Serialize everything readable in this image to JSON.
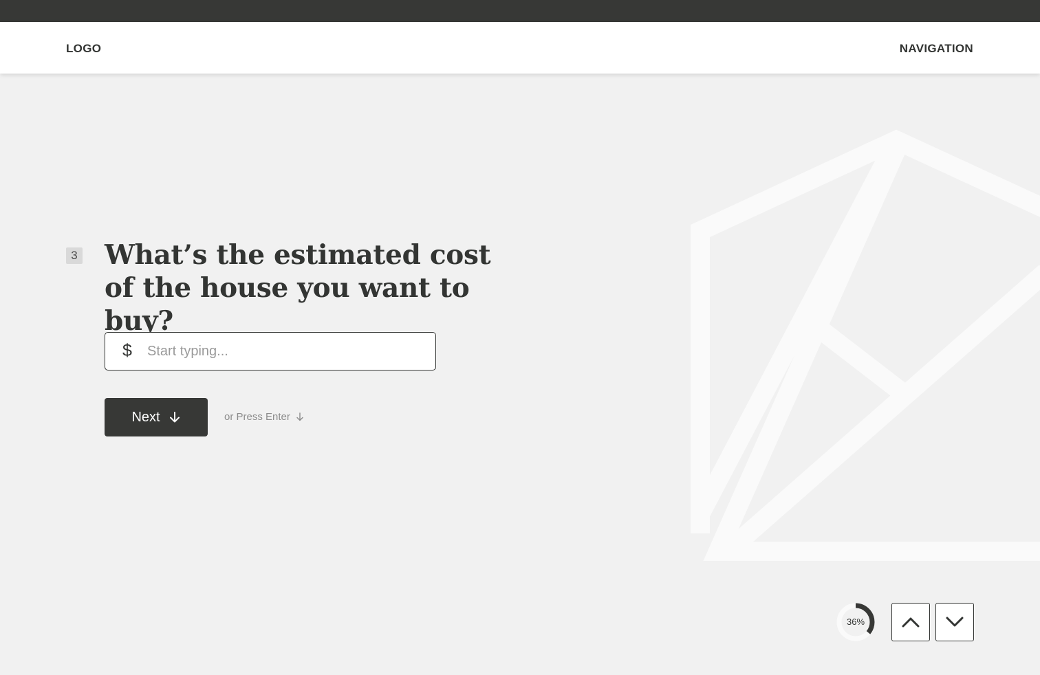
{
  "header": {
    "logo": "LOGO",
    "navigation": "NAVIGATION"
  },
  "question": {
    "number": "3",
    "text": "What’s the estimated cost of the house you want to buy?"
  },
  "input": {
    "currency_symbol": "$",
    "placeholder": "Start typing...",
    "value": ""
  },
  "actions": {
    "next_label": "Next",
    "enter_hint": "or Press Enter"
  },
  "progress": {
    "percent_label": "36%",
    "value": 0.36
  },
  "icons": {
    "next": "arrow-down-icon",
    "enter": "arrow-down-icon",
    "prev_question": "chevron-up-icon",
    "next_question": "chevron-down-icon",
    "background": "house-outline-illustration"
  },
  "colors": {
    "background": "#f1f1f1",
    "dark": "#373836",
    "accent_text": "#333533",
    "deco": "#fafafa"
  }
}
